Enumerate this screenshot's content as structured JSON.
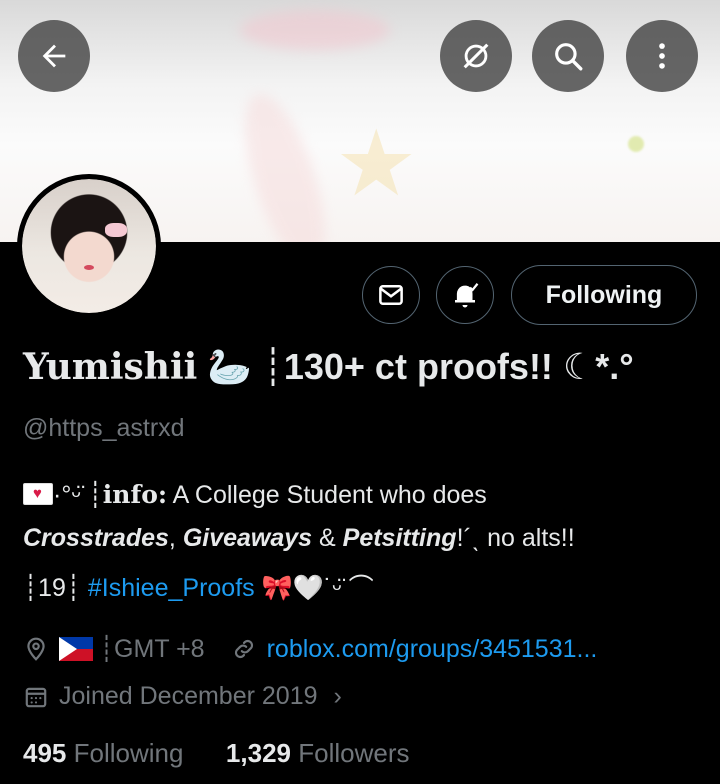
{
  "header": {
    "back_icon": "arrow-left-icon",
    "grok_icon": "grok-icon",
    "search_icon": "search-icon",
    "more_icon": "more-vertical-icon"
  },
  "profile": {
    "name_text": "Yumishii",
    "name_emoji": "🦢",
    "name_rest": "┊130+ ct proofs!!",
    "name_tail": "☾*.°",
    "handle": "@https_astrxd",
    "follow_button_label": "Following",
    "message_icon": "envelope-icon",
    "notification_icon": "bell-check-icon"
  },
  "bio": {
    "line1_pre": "·°ᵕ̈ ┊",
    "line1_info_label": "info:",
    "line1_text": " A College Student who does",
    "line2_crosstrades": "Crosstrades",
    "line2_sep1": ", ",
    "line2_giveaways": "Giveaways",
    "line2_sep2": " & ",
    "line2_petsitting": "Petsitting",
    "line2_rest": "!´ˎ no alts!!",
    "line3_pre": "┊19┊",
    "line3_hashtag": "#Ishiee_Proofs",
    "line3_post": " 🎀🤍˙ᵕ̈ ⌒"
  },
  "meta": {
    "location_icon": "location-pin-icon",
    "location_text": "┊GMT +8",
    "link_icon": "link-icon",
    "link_text": "roblox.com/groups/3451531...",
    "calendar_icon": "calendar-icon",
    "joined_text": "Joined December 2019",
    "chevron": "›"
  },
  "stats": {
    "following_count": "495",
    "following_label": "Following",
    "followers_count": "1,329",
    "followers_label": "Followers"
  },
  "colors": {
    "background": "#000000",
    "text": "#e7e9ea",
    "secondary": "#71767b",
    "link": "#1d9bf0",
    "border": "#536471"
  }
}
